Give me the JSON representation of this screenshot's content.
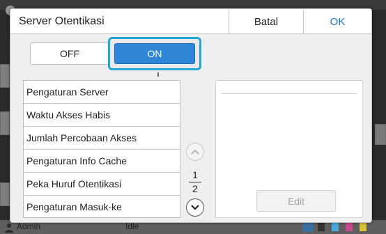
{
  "dialog": {
    "title": "Server Otentikasi",
    "cancel_label": "Batal",
    "ok_label": "OK"
  },
  "toggle": {
    "off_label": "OFF",
    "on_label": "ON",
    "selected": "ON"
  },
  "settings_list": {
    "items": [
      {
        "label": "Pengaturan Server"
      },
      {
        "label": "Waktu Akses Habis"
      },
      {
        "label": "Jumlah Percobaan Akses"
      },
      {
        "label": "Pengaturan Info Cache"
      },
      {
        "label": "Peka Huruf Otentikasi"
      },
      {
        "label": "Pengaturan Masuk-ke"
      }
    ]
  },
  "pager": {
    "current_page": "1",
    "total_pages": "2"
  },
  "detail": {
    "edit_label": "Edit"
  },
  "status_bar": {
    "user": "Admin",
    "status": "Idle"
  },
  "colors": {
    "accent": "#2f86d6",
    "highlight": "#22a6d8",
    "ok_text": "#1f78c8"
  },
  "icons": [
    "chevron-up-icon",
    "chevron-down-icon",
    "gear-icon",
    "admin-icon",
    "printer-icon"
  ]
}
